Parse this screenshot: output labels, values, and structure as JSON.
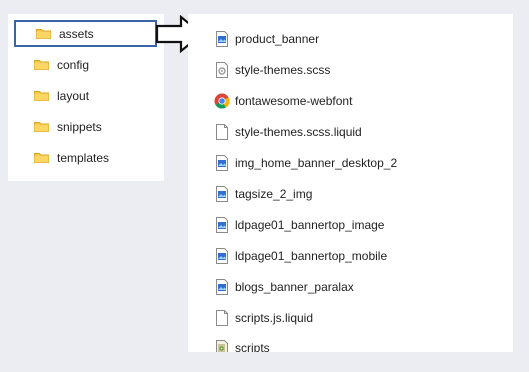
{
  "left_panel": {
    "folders": [
      {
        "label": "assets",
        "icon": "folder-icon",
        "selected": true
      },
      {
        "label": "config",
        "icon": "folder-icon",
        "selected": false
      },
      {
        "label": "layout",
        "icon": "folder-icon",
        "selected": false
      },
      {
        "label": "snippets",
        "icon": "folder-icon",
        "selected": false
      },
      {
        "label": "templates",
        "icon": "folder-icon",
        "selected": false
      }
    ]
  },
  "right_panel": {
    "files": [
      {
        "label": "product_banner",
        "icon": "image-file-icon"
      },
      {
        "label": "style-themes.scss",
        "icon": "settings-file-icon"
      },
      {
        "label": "fontawesome-webfont",
        "icon": "chrome-icon"
      },
      {
        "label": "style-themes.scss.liquid",
        "icon": "blank-file-icon"
      },
      {
        "label": "img_home_banner_desktop_2",
        "icon": "image-file-icon"
      },
      {
        "label": "tagsize_2_img",
        "icon": "image-file-icon"
      },
      {
        "label": "ldpage01_bannertop_image",
        "icon": "image-file-icon"
      },
      {
        "label": "ldpage01_bannertop_mobile",
        "icon": "image-file-icon"
      },
      {
        "label": "blogs_banner_paralax",
        "icon": "image-file-icon"
      },
      {
        "label": "scripts.js.liquid",
        "icon": "blank-file-icon"
      },
      {
        "label": "scripts",
        "icon": "script-file-icon"
      }
    ]
  },
  "colors": {
    "background": "#ecedf2",
    "panel": "#ffffff",
    "selection_border": "#3b64a8",
    "folder": "#f6c744"
  }
}
